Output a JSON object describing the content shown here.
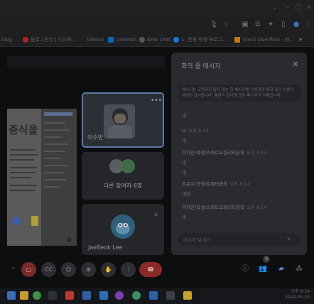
{
  "browser": {
    "bookmarks": [
      {
        "label": "blog",
        "color": ""
      },
      {
        "label": "블로그관리 | 티스토...",
        "color": "#b3261e"
      },
      {
        "label": "GitHub",
        "color": ""
      },
      {
        "label": "LinkedIn",
        "color": "#0a66c2"
      },
      {
        "label": "New chat",
        "color": "#555"
      },
      {
        "label": "1. 전체 학생 프로그...",
        "color": "#1a73e8"
      },
      {
        "label": "Stack Overflow - W...",
        "color": "#c6781f"
      }
    ],
    "bookmarks_more": "»"
  },
  "presentation": {
    "title": "증식을 정"
  },
  "tiles": {
    "speaker_name": "이수빈",
    "others_label": "다른 참여자 6명",
    "jae_name": "JaeSeok Lee"
  },
  "chat": {
    "title": "회의 중 메시지",
    "notice": "메시지는 고정하지 않지 않는 한 메시지를 전송하면 통화 중인 사용자에게만 표시됩니다. 통화가 끝나면 모든 메시지가 삭제됩니다.",
    "messages": [
      {
        "sender": "",
        "time": "",
        "lines": [
          "네"
        ]
      },
      {
        "sender": "나",
        "time": "오후 8:13",
        "lines": [
          "네"
        ]
      },
      {
        "sender": "이지민/학생/스마트모빌리티공학",
        "time": "오후 8:14",
        "lines": [
          "네",
          "네"
        ]
      },
      {
        "sender": "조은우/학생/컴퓨터공학",
        "time": "오후 8:14",
        "lines": [
          "네네"
        ]
      },
      {
        "sender": "이지민/학생/스마트모빌리티공학",
        "time": "오후 8:14",
        "lines": [
          "네"
        ]
      }
    ],
    "input_placeholder": "메시지 보내기"
  },
  "controls": {
    "people_count": "9"
  },
  "taskbar": {
    "time": "오후 8:14",
    "date": "2024-05-20"
  },
  "colors": {
    "hangup": "#8a2a26",
    "chat_panel": "#2a2b2e",
    "active_tile_border": "#5c7aa6"
  }
}
